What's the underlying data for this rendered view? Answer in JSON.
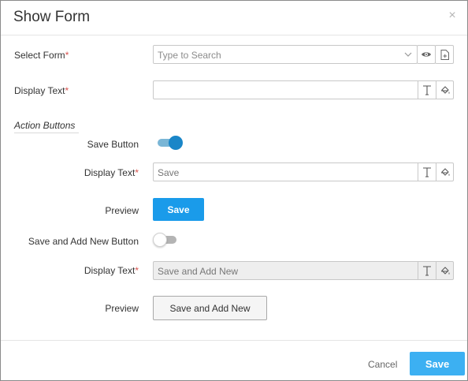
{
  "dialog": {
    "title": "Show Form",
    "close_icon": "close-icon"
  },
  "fields": {
    "select_form": {
      "label": "Select Form",
      "required": "*",
      "placeholder": "Type to Search",
      "value": ""
    },
    "display_text": {
      "label": "Display Text",
      "required": "*",
      "value": ""
    }
  },
  "action_buttons": {
    "section_title": "Action Buttons",
    "save_button": {
      "label": "Save Button",
      "enabled": true,
      "display_text_label": "Display Text",
      "required": "*",
      "display_text_value": "Save",
      "preview_label": "Preview",
      "preview_button": "Save"
    },
    "save_and_add_new": {
      "label": "Save and Add New Button",
      "enabled": false,
      "display_text_label": "Display Text",
      "required": "*",
      "display_text_value": "Save and Add New",
      "preview_label": "Preview",
      "preview_button": "Save and Add New"
    }
  },
  "footer": {
    "cancel_label": "Cancel",
    "save_label": "Save"
  },
  "colors": {
    "primary": "#1a9bea",
    "required": "#d9534f",
    "toggle_on": "#1a86c8"
  }
}
